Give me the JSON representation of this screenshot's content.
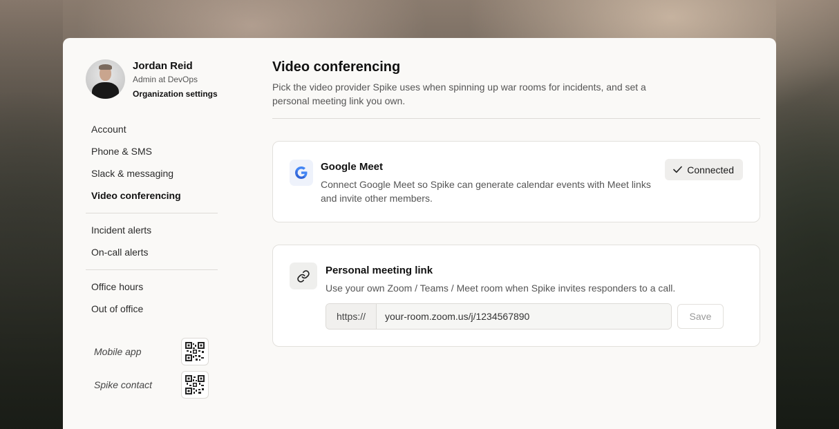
{
  "profile": {
    "name": "Jordan Reid",
    "role": "Admin at DevOps",
    "org_link": "Organization settings"
  },
  "nav": {
    "group1": [
      "Account",
      "Phone & SMS",
      "Slack & messaging",
      "Video conferencing"
    ],
    "group2": [
      "Incident alerts",
      "On-call alerts"
    ],
    "group3": [
      "Office hours",
      "Out of office"
    ],
    "active": "Video conferencing"
  },
  "qr": {
    "mobile_label": "Mobile app",
    "contact_label": "Spike contact"
  },
  "page": {
    "title": "Video conferencing",
    "description": "Pick the video provider Spike uses when spinning up war rooms for incidents, and set a personal meeting link you own."
  },
  "google_meet": {
    "title": "Google Meet",
    "description": "Connect Google Meet so Spike can generate calendar events with Meet links and invite other members.",
    "status": "Connected"
  },
  "personal_link": {
    "title": "Personal meeting link",
    "description": "Use your own Zoom / Teams / Meet room when Spike invites responders to a call.",
    "prefix": "https://",
    "value": "your-room.zoom.us/j/1234567890",
    "save_label": "Save"
  },
  "colors": {
    "panel_bg": "#faf9f7",
    "google_blue": "#4285f4"
  }
}
